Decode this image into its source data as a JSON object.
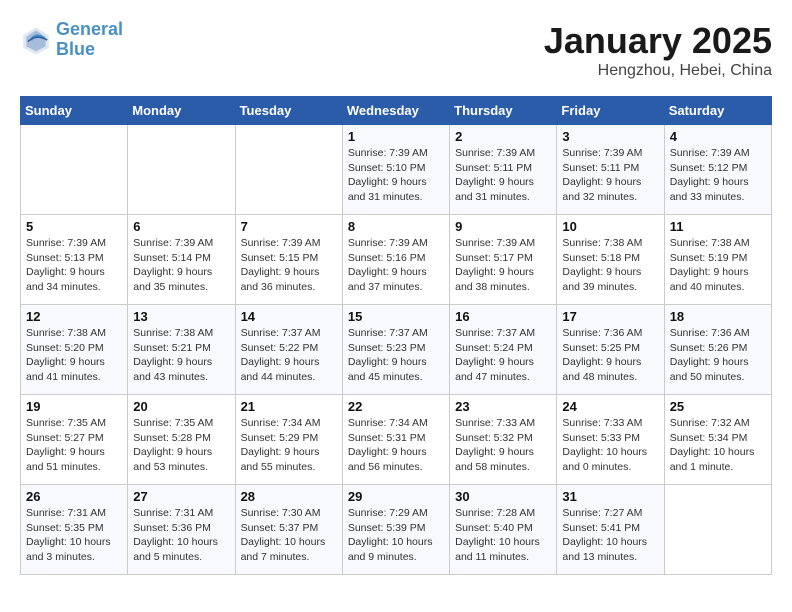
{
  "header": {
    "logo_line1": "General",
    "logo_line2": "Blue",
    "title": "January 2025",
    "subtitle": "Hengzhou, Hebei, China"
  },
  "days_of_week": [
    "Sunday",
    "Monday",
    "Tuesday",
    "Wednesday",
    "Thursday",
    "Friday",
    "Saturday"
  ],
  "weeks": [
    [
      {
        "day": "",
        "detail": ""
      },
      {
        "day": "",
        "detail": ""
      },
      {
        "day": "",
        "detail": ""
      },
      {
        "day": "1",
        "detail": "Sunrise: 7:39 AM\nSunset: 5:10 PM\nDaylight: 9 hours\nand 31 minutes."
      },
      {
        "day": "2",
        "detail": "Sunrise: 7:39 AM\nSunset: 5:11 PM\nDaylight: 9 hours\nand 31 minutes."
      },
      {
        "day": "3",
        "detail": "Sunrise: 7:39 AM\nSunset: 5:11 PM\nDaylight: 9 hours\nand 32 minutes."
      },
      {
        "day": "4",
        "detail": "Sunrise: 7:39 AM\nSunset: 5:12 PM\nDaylight: 9 hours\nand 33 minutes."
      }
    ],
    [
      {
        "day": "5",
        "detail": "Sunrise: 7:39 AM\nSunset: 5:13 PM\nDaylight: 9 hours\nand 34 minutes."
      },
      {
        "day": "6",
        "detail": "Sunrise: 7:39 AM\nSunset: 5:14 PM\nDaylight: 9 hours\nand 35 minutes."
      },
      {
        "day": "7",
        "detail": "Sunrise: 7:39 AM\nSunset: 5:15 PM\nDaylight: 9 hours\nand 36 minutes."
      },
      {
        "day": "8",
        "detail": "Sunrise: 7:39 AM\nSunset: 5:16 PM\nDaylight: 9 hours\nand 37 minutes."
      },
      {
        "day": "9",
        "detail": "Sunrise: 7:39 AM\nSunset: 5:17 PM\nDaylight: 9 hours\nand 38 minutes."
      },
      {
        "day": "10",
        "detail": "Sunrise: 7:38 AM\nSunset: 5:18 PM\nDaylight: 9 hours\nand 39 minutes."
      },
      {
        "day": "11",
        "detail": "Sunrise: 7:38 AM\nSunset: 5:19 PM\nDaylight: 9 hours\nand 40 minutes."
      }
    ],
    [
      {
        "day": "12",
        "detail": "Sunrise: 7:38 AM\nSunset: 5:20 PM\nDaylight: 9 hours\nand 41 minutes."
      },
      {
        "day": "13",
        "detail": "Sunrise: 7:38 AM\nSunset: 5:21 PM\nDaylight: 9 hours\nand 43 minutes."
      },
      {
        "day": "14",
        "detail": "Sunrise: 7:37 AM\nSunset: 5:22 PM\nDaylight: 9 hours\nand 44 minutes."
      },
      {
        "day": "15",
        "detail": "Sunrise: 7:37 AM\nSunset: 5:23 PM\nDaylight: 9 hours\nand 45 minutes."
      },
      {
        "day": "16",
        "detail": "Sunrise: 7:37 AM\nSunset: 5:24 PM\nDaylight: 9 hours\nand 47 minutes."
      },
      {
        "day": "17",
        "detail": "Sunrise: 7:36 AM\nSunset: 5:25 PM\nDaylight: 9 hours\nand 48 minutes."
      },
      {
        "day": "18",
        "detail": "Sunrise: 7:36 AM\nSunset: 5:26 PM\nDaylight: 9 hours\nand 50 minutes."
      }
    ],
    [
      {
        "day": "19",
        "detail": "Sunrise: 7:35 AM\nSunset: 5:27 PM\nDaylight: 9 hours\nand 51 minutes."
      },
      {
        "day": "20",
        "detail": "Sunrise: 7:35 AM\nSunset: 5:28 PM\nDaylight: 9 hours\nand 53 minutes."
      },
      {
        "day": "21",
        "detail": "Sunrise: 7:34 AM\nSunset: 5:29 PM\nDaylight: 9 hours\nand 55 minutes."
      },
      {
        "day": "22",
        "detail": "Sunrise: 7:34 AM\nSunset: 5:31 PM\nDaylight: 9 hours\nand 56 minutes."
      },
      {
        "day": "23",
        "detail": "Sunrise: 7:33 AM\nSunset: 5:32 PM\nDaylight: 9 hours\nand 58 minutes."
      },
      {
        "day": "24",
        "detail": "Sunrise: 7:33 AM\nSunset: 5:33 PM\nDaylight: 10 hours\nand 0 minutes."
      },
      {
        "day": "25",
        "detail": "Sunrise: 7:32 AM\nSunset: 5:34 PM\nDaylight: 10 hours\nand 1 minute."
      }
    ],
    [
      {
        "day": "26",
        "detail": "Sunrise: 7:31 AM\nSunset: 5:35 PM\nDaylight: 10 hours\nand 3 minutes."
      },
      {
        "day": "27",
        "detail": "Sunrise: 7:31 AM\nSunset: 5:36 PM\nDaylight: 10 hours\nand 5 minutes."
      },
      {
        "day": "28",
        "detail": "Sunrise: 7:30 AM\nSunset: 5:37 PM\nDaylight: 10 hours\nand 7 minutes."
      },
      {
        "day": "29",
        "detail": "Sunrise: 7:29 AM\nSunset: 5:39 PM\nDaylight: 10 hours\nand 9 minutes."
      },
      {
        "day": "30",
        "detail": "Sunrise: 7:28 AM\nSunset: 5:40 PM\nDaylight: 10 hours\nand 11 minutes."
      },
      {
        "day": "31",
        "detail": "Sunrise: 7:27 AM\nSunset: 5:41 PM\nDaylight: 10 hours\nand 13 minutes."
      },
      {
        "day": "",
        "detail": ""
      }
    ]
  ]
}
